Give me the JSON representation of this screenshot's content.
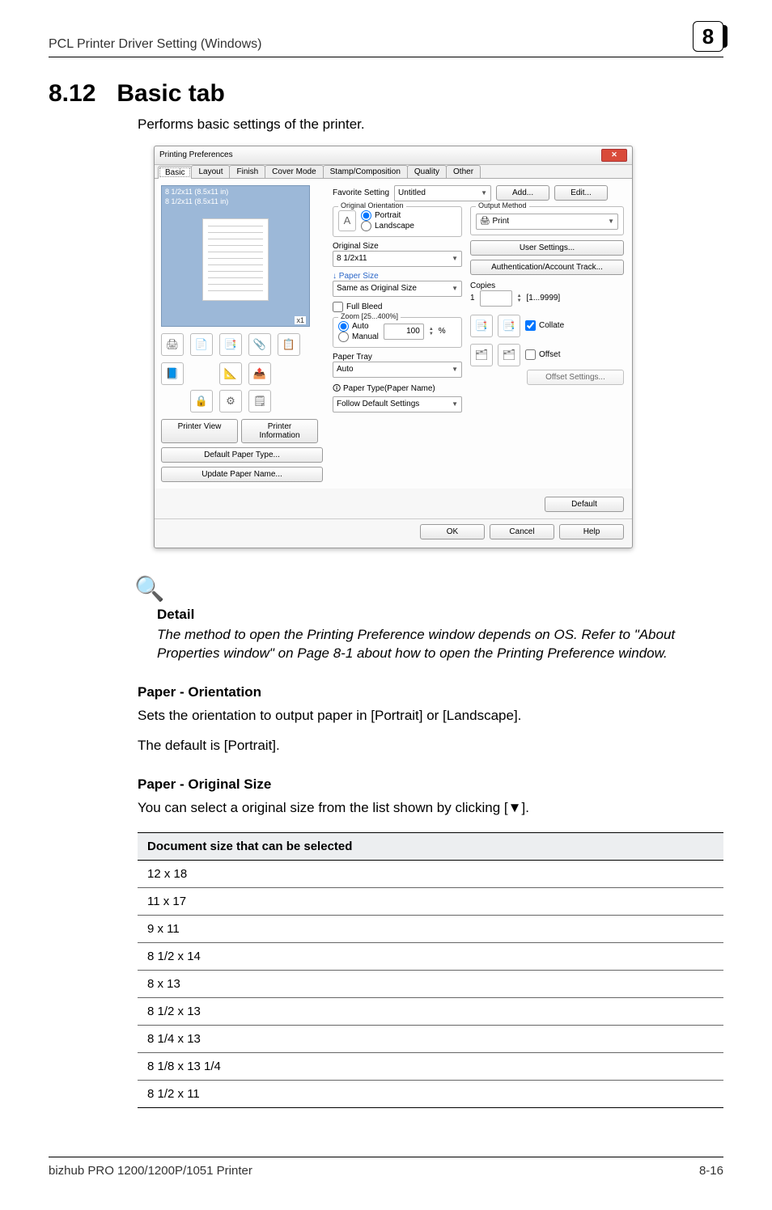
{
  "header": {
    "section": "PCL Printer Driver Setting (Windows)",
    "chapter_num": "8"
  },
  "section": {
    "number": "8.12",
    "title": "Basic tab",
    "intro": "Performs basic settings of the printer."
  },
  "screenshot": {
    "window_title": "Printing Preferences",
    "tabs": [
      "Basic",
      "Layout",
      "Finish",
      "Cover Mode",
      "Stamp/Composition",
      "Quality",
      "Other"
    ],
    "preview": {
      "line1": "8 1/2x11 (8.5x11 in)",
      "line2": "8 1/2x11 (8.5x11 in)",
      "scale": "x1"
    },
    "left_buttons": {
      "printer_view": "Printer View",
      "printer_info": "Printer Information",
      "default_paper_type": "Default Paper Type...",
      "update_paper_name": "Update Paper Name..."
    },
    "favorite": {
      "label": "Favorite Setting",
      "value": "Untitled",
      "add": "Add...",
      "edit": "Edit..."
    },
    "orientation": {
      "group": "Original Orientation",
      "portrait": "Portrait",
      "landscape": "Landscape"
    },
    "original_size": {
      "label": "Original Size",
      "value": "8 1/2x11"
    },
    "paper_size": {
      "label": "Paper Size",
      "value": "Same as Original Size"
    },
    "full_bleed": "Full Bleed",
    "zoom": {
      "group": "Zoom [25...400%]",
      "auto": "Auto",
      "manual": "Manual",
      "value": "100",
      "pct": "%"
    },
    "paper_tray": {
      "label": "Paper Tray",
      "value": "Auto"
    },
    "paper_type": {
      "label": "Paper Type(Paper Name)",
      "value": "Follow Default Settings"
    },
    "output_method": {
      "group": "Output Method",
      "value": "Print"
    },
    "user_settings": "User Settings...",
    "auth": "Authentication/Account Track...",
    "copies": {
      "label": "Copies",
      "value": "1",
      "range": "[1...9999]"
    },
    "collate": "Collate",
    "offset": "Offset",
    "offset_settings": "Offset Settings...",
    "default": "Default",
    "footer_buttons": {
      "ok": "OK",
      "cancel": "Cancel",
      "help": "Help"
    }
  },
  "detail": {
    "heading": "Detail",
    "body": "The method to open the Printing Preference window depends on OS. Refer to \"About Properties window\" on Page 8-1 about how to open the Printing Preference window."
  },
  "subsections": {
    "orientation": {
      "title": "Paper - Orientation",
      "p1": "Sets the orientation to output paper in [Portrait] or [Landscape].",
      "p2": "The default is [Portrait]."
    },
    "original_size": {
      "title": "Paper - Original Size",
      "p1": "You can select a original size from the list shown by clicking [▼]."
    }
  },
  "sizes_table": {
    "header": "Document size that can be selected",
    "rows": [
      "12 x 18",
      "11 x 17",
      "9 x 11",
      "8 1/2 x 14",
      "8 x 13",
      "8 1/2 x 13",
      "8 1/4 x 13",
      "8 1/8 x 13 1/4",
      "8 1/2 x 11"
    ]
  },
  "footer": {
    "left": "bizhub PRO 1200/1200P/1051 Printer",
    "right": "8-16"
  }
}
